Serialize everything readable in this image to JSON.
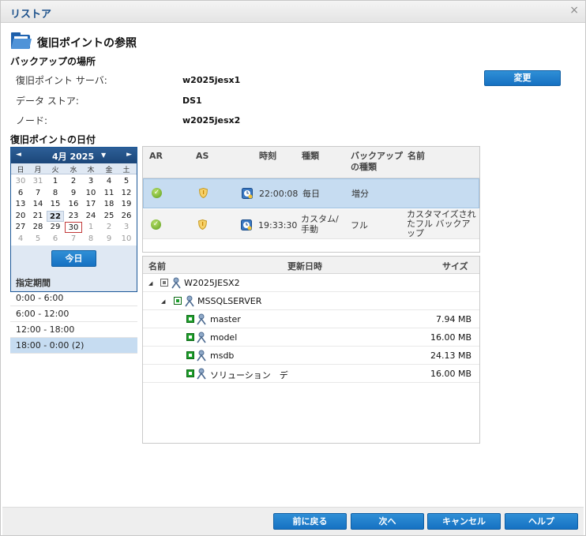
{
  "window": {
    "title": "リストア",
    "close_glyph": "×"
  },
  "heading": "復旧ポイントの参照",
  "backup_location": {
    "section_label": "バックアップの場所",
    "rows": [
      {
        "label": "復旧ポイント サーバ:",
        "value": "w2025jesx1"
      },
      {
        "label": "データ ストア:",
        "value": "DS1"
      },
      {
        "label": "ノード:",
        "value": "w2025jesx2"
      }
    ],
    "change_button": "変更"
  },
  "date_section_label": "復旧ポイントの日付",
  "calendar": {
    "month": "4月 2025",
    "prev_glyph": "◄",
    "next_glyph": "►",
    "dropdown_glyph": "▼",
    "weekdays": [
      "日",
      "月",
      "火",
      "水",
      "木",
      "金",
      "土"
    ],
    "weeks": [
      [
        "30",
        "31",
        "1",
        "2",
        "3",
        "4",
        "5"
      ],
      [
        "6",
        "7",
        "8",
        "9",
        "10",
        "11",
        "12"
      ],
      [
        "13",
        "14",
        "15",
        "16",
        "17",
        "18",
        "19"
      ],
      [
        "20",
        "21",
        "22",
        "23",
        "24",
        "25",
        "26"
      ],
      [
        "27",
        "28",
        "29",
        "30",
        "1",
        "2",
        "3"
      ],
      [
        "4",
        "5",
        "6",
        "7",
        "8",
        "9",
        "10"
      ]
    ],
    "today_button": "今日"
  },
  "period": {
    "title": "指定期間",
    "items": [
      "0:00 - 6:00",
      "6:00 - 12:00",
      "12:00 - 18:00",
      "18:00 - 0:00  (2)"
    ]
  },
  "recovery_points": {
    "headers": {
      "ar": "AR",
      "as": "AS",
      "time": "時刻",
      "type": "種類",
      "backup_type_1": "バックアップ",
      "backup_type_2": "の種類",
      "name": "名前"
    },
    "rows": [
      {
        "time": "22:00:08",
        "type_1": "毎日",
        "type_2": "",
        "backup_type": "増分",
        "name_1": "",
        "name_2": "",
        "name_3": ""
      },
      {
        "time": "19:33:30",
        "type_1": "カスタム/",
        "type_2": "手動",
        "backup_type": "フル",
        "name_1": "カスタマイズされ",
        "name_2": "たフル バックア",
        "name_3": "ップ"
      }
    ]
  },
  "tree": {
    "headers": {
      "name": "名前",
      "modified": "更新日時",
      "size": "サイズ"
    },
    "rows": [
      {
        "name": "W2025JESX2",
        "size": ""
      },
      {
        "name": "MSSQLSERVER",
        "size": ""
      },
      {
        "name": "master",
        "size": "7.94 MB"
      },
      {
        "name": "model",
        "size": "16.00 MB"
      },
      {
        "name": "msdb",
        "size": "24.13 MB"
      },
      {
        "name": "ソリューション　デ",
        "size": "16.00 MB"
      }
    ],
    "expand_glyph": "◢"
  },
  "footer": {
    "back": "前に戻る",
    "next": "次へ",
    "cancel": "キャンセル",
    "help": "ヘルプ"
  },
  "colors": {
    "accent": "#1671c2",
    "selection": "#c6dcf1",
    "calendar_header": "#1b4679"
  }
}
